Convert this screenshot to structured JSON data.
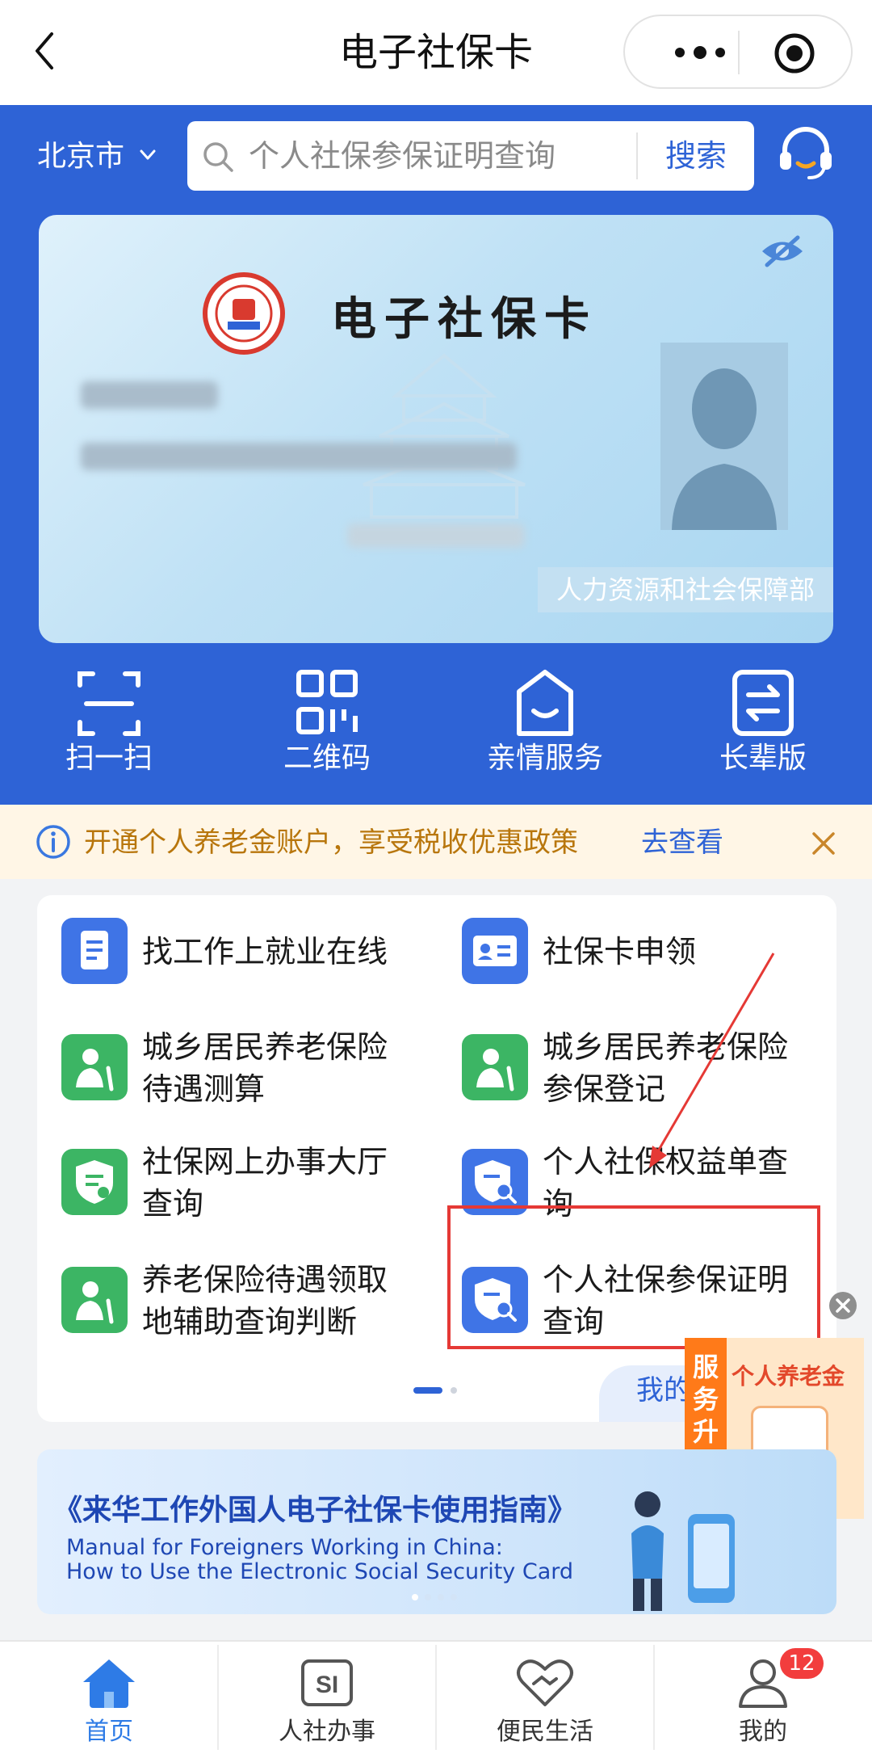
{
  "nav": {
    "title": "电子社保卡"
  },
  "header": {
    "city": "北京市",
    "search_placeholder": "个人社保参保证明查询",
    "search_button": "搜索"
  },
  "card": {
    "title": "电子社保卡",
    "issuer": "人力资源和社会保障部"
  },
  "quick_actions": [
    {
      "label": "扫一扫",
      "icon": "scan-icon"
    },
    {
      "label": "二维码",
      "icon": "qrcode-icon"
    },
    {
      "label": "亲情服务",
      "icon": "family-service-icon"
    },
    {
      "label": "长辈版",
      "icon": "elder-mode-icon"
    }
  ],
  "notice": {
    "text": "开通个人养老金账户，享受税收优惠政策",
    "link": "去查看"
  },
  "services": [
    {
      "line1": "找工作上就业在线",
      "line2": "",
      "icon": "document-icon",
      "color": "#3f74e6"
    },
    {
      "line1": "社保卡申领",
      "line2": "",
      "icon": "id-card-icon",
      "color": "#3f74e6"
    },
    {
      "line1": "城乡居民养老保险",
      "line2": "待遇测算",
      "icon": "elderly-person-icon",
      "color": "#3cb564"
    },
    {
      "line1": "城乡居民养老保险",
      "line2": "参保登记",
      "icon": "elderly-person-icon",
      "color": "#3cb564"
    },
    {
      "line1": "社保网上办事大厅",
      "line2": "查询",
      "icon": "shield-doc-icon",
      "color": "#3cb564"
    },
    {
      "line1": "个人社保权益单查",
      "line2": "询",
      "icon": "shield-search-icon",
      "color": "#3f74e6"
    },
    {
      "line1": "养老保险待遇领取",
      "line2": "地辅助查询判断",
      "icon": "elderly-person-icon",
      "color": "#3cb564"
    },
    {
      "line1": "个人社保参保证明",
      "line2": "查询",
      "icon": "shield-search-icon",
      "color": "#3f74e6"
    }
  ],
  "mine_tab": "我的",
  "float_ad": {
    "side_text": "服务升级啦",
    "title": "个人养老金"
  },
  "banner": {
    "title": "《来华工作外国人电子社保卡使用指南》",
    "subtitle_line1": "Manual for Foreigners Working in China:",
    "subtitle_line2": "How to Use the Electronic Social Security Card"
  },
  "tabbar": [
    {
      "label": "首页",
      "icon": "home-icon",
      "active": true
    },
    {
      "label": "人社办事",
      "icon": "si-icon",
      "active": false
    },
    {
      "label": "便民生活",
      "icon": "heart-handshake-icon",
      "active": false
    },
    {
      "label": "我的",
      "icon": "user-icon",
      "active": false
    }
  ],
  "badge_count": "12",
  "colors": {
    "primary": "#2e63d6",
    "notice_text": "#b8760c",
    "highlight": "#e53935"
  }
}
